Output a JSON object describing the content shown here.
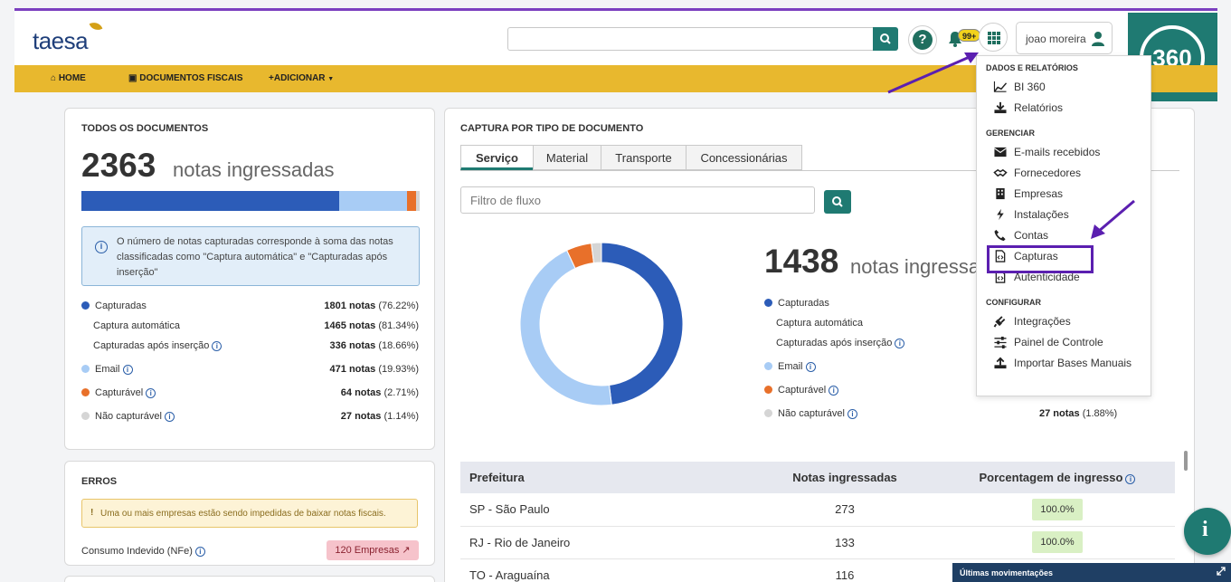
{
  "header": {
    "logo_text": "taesa",
    "search_placeholder": "",
    "notification_badge": "99+",
    "user_name": "joao moreira",
    "brand_text": "360"
  },
  "nav": {
    "home": "HOME",
    "fiscal_docs": "DOCUMENTOS FISCAIS",
    "add": "ADICIONAR"
  },
  "all_docs": {
    "title": "TODOS OS DOCUMENTOS",
    "total": "2363",
    "total_label": "notas ingressadas",
    "info_text": "O número de notas capturadas corresponde à soma das notas classificadas como \"Captura automática\" e \"Capturadas após inserção\"",
    "rows": [
      {
        "label": "Capturadas",
        "count": "1801 notas",
        "pct": "(76.22%)"
      },
      {
        "label": "Captura automática",
        "count": "1465 notas",
        "pct": "(81.34%)"
      },
      {
        "label": "Capturadas após inserção",
        "count": "336 notas",
        "pct": "(18.66%)"
      },
      {
        "label": "Email",
        "count": "471 notas",
        "pct": "(19.93%)"
      },
      {
        "label": "Capturável",
        "count": "64 notas",
        "pct": "(2.71%)"
      },
      {
        "label": "Não capturável",
        "count": "27 notas",
        "pct": "(1.14%)"
      }
    ],
    "bar_fractions": [
      0.7622,
      0.1993,
      0.0271,
      0.0114
    ]
  },
  "errors": {
    "title": "ERROS",
    "warning": "Uma ou mais empresas estão sendo impedidas de baixar notas fiscais.",
    "metric_label": "Consumo Indevido (NFe)",
    "metric_value": "120 Empresas"
  },
  "capture": {
    "title": "CAPTURA POR TIPO DE DOCUMENTO",
    "tabs": [
      "Serviço",
      "Material",
      "Transporte",
      "Concessionárias"
    ],
    "active_tab": "Serviço",
    "filter_placeholder": "Filtro de fluxo",
    "total": "1438",
    "total_label": "notas ingressa",
    "legend": [
      {
        "label": "Capturadas"
      },
      {
        "label": "Captura automática"
      },
      {
        "label": "Capturadas após inserção"
      },
      {
        "label": "Email"
      },
      {
        "label": "Capturável"
      },
      {
        "label": "Não capturável",
        "count": "27 notas",
        "pct": "(1.88%)"
      }
    ],
    "donut_fractions": [
      0.48,
      0.45,
      0.05,
      0.02
    ],
    "table": {
      "headers": [
        "Prefeitura",
        "Notas ingressadas",
        "Porcentagem de ingresso"
      ],
      "rows": [
        {
          "city": "SP - São Paulo",
          "count": "273",
          "pct": "100.0%"
        },
        {
          "city": "RJ - Rio de Janeiro",
          "count": "133",
          "pct": "100.0%"
        },
        {
          "city": "TO - Araguaína",
          "count": "116",
          "pct": ""
        }
      ]
    }
  },
  "dropdown": {
    "sections": [
      {
        "title": "DADOS E RELATÓRIOS",
        "items": [
          "BI 360",
          "Relatórios"
        ]
      },
      {
        "title": "GERENCIAR",
        "items": [
          "E-mails recebidos",
          "Fornecedores",
          "Empresas",
          "Instalações",
          "Contas",
          "Capturas",
          "Autenticidade"
        ]
      },
      {
        "title": "CONFIGURAR",
        "items": [
          "Integrações",
          "Painel de Controle",
          "Importar Bases Manuais"
        ]
      }
    ],
    "highlighted_item": "Capturas"
  },
  "footer": {
    "ultimas": "Últimas movimentações"
  },
  "colors": {
    "teal": "#1f7a72",
    "nav_yellow": "#e8b82e",
    "capturadas": "#2c5cb8",
    "email": "#a8ccf5",
    "capturavel": "#e8702a",
    "nao_capturavel": "#d5d5d5",
    "highlight": "#5b1fb0"
  }
}
